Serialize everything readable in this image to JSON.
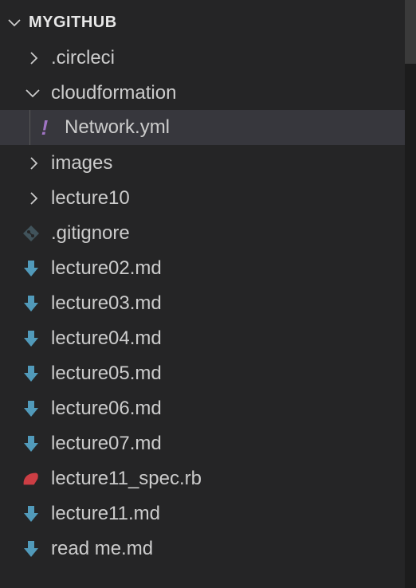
{
  "explorer": {
    "section_title": "MYGITHUB",
    "items": [
      {
        "label": ".circleci",
        "type": "folder",
        "expanded": false,
        "icon": "chevron-right-icon"
      },
      {
        "label": "cloudformation",
        "type": "folder",
        "expanded": true,
        "icon": "chevron-down-icon"
      },
      {
        "label": "Network.yml",
        "type": "file",
        "icon": "yaml-exclamation-icon",
        "selected": true,
        "icon_glyph": "!"
      },
      {
        "label": "images",
        "type": "folder",
        "expanded": false,
        "icon": "chevron-right-icon"
      },
      {
        "label": "lecture10",
        "type": "folder",
        "expanded": false,
        "icon": "chevron-right-icon"
      },
      {
        "label": ".gitignore",
        "type": "file",
        "icon": "git-icon"
      },
      {
        "label": "lecture02.md",
        "type": "file",
        "icon": "markdown-arrow-icon"
      },
      {
        "label": "lecture03.md",
        "type": "file",
        "icon": "markdown-arrow-icon"
      },
      {
        "label": "lecture04.md",
        "type": "file",
        "icon": "markdown-arrow-icon"
      },
      {
        "label": "lecture05.md",
        "type": "file",
        "icon": "markdown-arrow-icon"
      },
      {
        "label": "lecture06.md",
        "type": "file",
        "icon": "markdown-arrow-icon"
      },
      {
        "label": "lecture07.md",
        "type": "file",
        "icon": "markdown-arrow-icon"
      },
      {
        "label": "lecture11_spec.rb",
        "type": "file",
        "icon": "ruby-icon"
      },
      {
        "label": "lecture11.md",
        "type": "file",
        "icon": "markdown-arrow-icon"
      },
      {
        "label": "read me.md",
        "type": "file",
        "icon": "markdown-arrow-icon"
      }
    ]
  },
  "colors": {
    "background": "#252526",
    "selected_row": "#37373d",
    "text": "#cccccc",
    "markdown_icon": "#519aba",
    "yaml_icon": "#a074c4",
    "ruby_icon": "#cc3e44",
    "git_icon": "#41535b"
  }
}
